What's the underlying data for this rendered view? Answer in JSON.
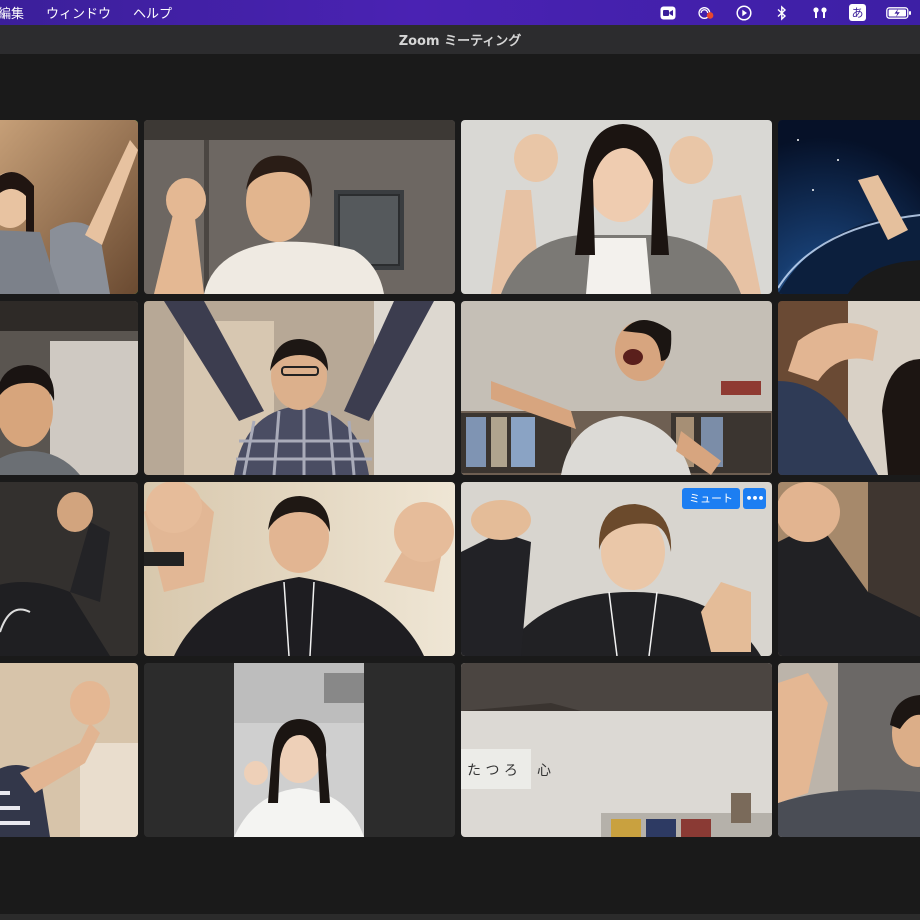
{
  "menubar": {
    "items": [
      "編集",
      "ウィンドウ",
      "ヘルプ"
    ],
    "status_icons": [
      "zoom-video-icon",
      "screen-record-icon",
      "play-icon",
      "bluetooth-icon",
      "airpods-icon",
      "ime-icon",
      "battery-icon"
    ],
    "ime_label": "あ"
  },
  "window": {
    "title": "Zoom ミーティング"
  },
  "tiles": [
    {
      "participant": "participant-1",
      "active_speaker": true
    },
    {
      "participant": "participant-2"
    },
    {
      "participant": "participant-3"
    },
    {
      "participant": "participant-4"
    },
    {
      "participant": "participant-5"
    },
    {
      "participant": "participant-6"
    },
    {
      "participant": "participant-7"
    },
    {
      "participant": "participant-8"
    },
    {
      "participant": "participant-9"
    },
    {
      "participant": "participant-10"
    },
    {
      "participant": "participant-11"
    },
    {
      "participant": "participant-12"
    },
    {
      "participant": "participant-13"
    },
    {
      "participant": "participant-14"
    },
    {
      "participant": "participant-15"
    },
    {
      "participant": "participant-16"
    }
  ],
  "hover_controls": {
    "mute_label": "ミュート",
    "more_label": "•••"
  },
  "colors": {
    "active_speaker_border": "#27d23a",
    "button_blue": "#1c7ef2",
    "menubar": "#4a22b3"
  }
}
